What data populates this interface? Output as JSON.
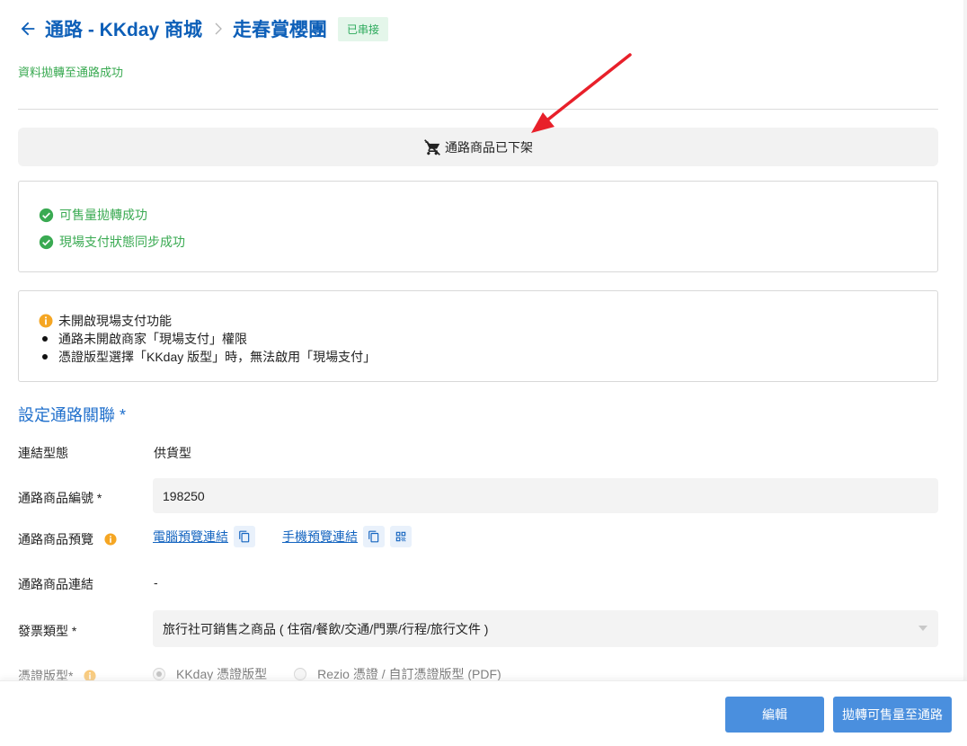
{
  "header": {
    "title": "通路 - KKday 商城",
    "subtitle": "走春賞櫻團",
    "tag": "已串接"
  },
  "success_message": "資料拋轉至通路成功",
  "delist_button": {
    "label": "通路商品已下架",
    "icon": "remove-shopping-cart-icon"
  },
  "status_box": {
    "items": [
      "可售量拋轉成功",
      "現場支付狀態同步成功"
    ]
  },
  "notice_box": {
    "title": "未開啟現場支付功能",
    "bullets": [
      "通路未開啟商家「現場支付」權限",
      "憑證版型選擇「KKday 版型」時，無法啟用「現場支付」"
    ]
  },
  "section": {
    "title": "設定通路關聯 *"
  },
  "form": {
    "link_type": {
      "label": "連結型態",
      "value": "供貨型"
    },
    "product_id": {
      "label": "通路商品編號 *",
      "value": "198250"
    },
    "preview": {
      "label": "通路商品預覽",
      "desktop_link": "電腦預覽連結",
      "mobile_link": "手機預覽連結"
    },
    "product_link": {
      "label": "通路商品連結",
      "value": "-"
    },
    "invoice_type": {
      "label": "發票類型 *",
      "value": "旅行社可銷售之商品 ( 住宿/餐飲/交通/門票/行程/旅行文件 )"
    },
    "voucher_type": {
      "label": "憑證版型*",
      "options": [
        "KKday 憑證版型",
        "Rezio 憑證 / 自訂憑證版型 (PDF)"
      ],
      "selected": "KKday 憑證版型"
    }
  },
  "footer": {
    "edit_label": "編輯",
    "sync_label": "拋轉可售量至通路"
  },
  "colors": {
    "primary_blue": "#0d5fb8",
    "button_blue": "#4a8fde",
    "success_green": "#3aaa52",
    "warning_orange": "#f5a623",
    "annotation_red": "#e8202a"
  }
}
